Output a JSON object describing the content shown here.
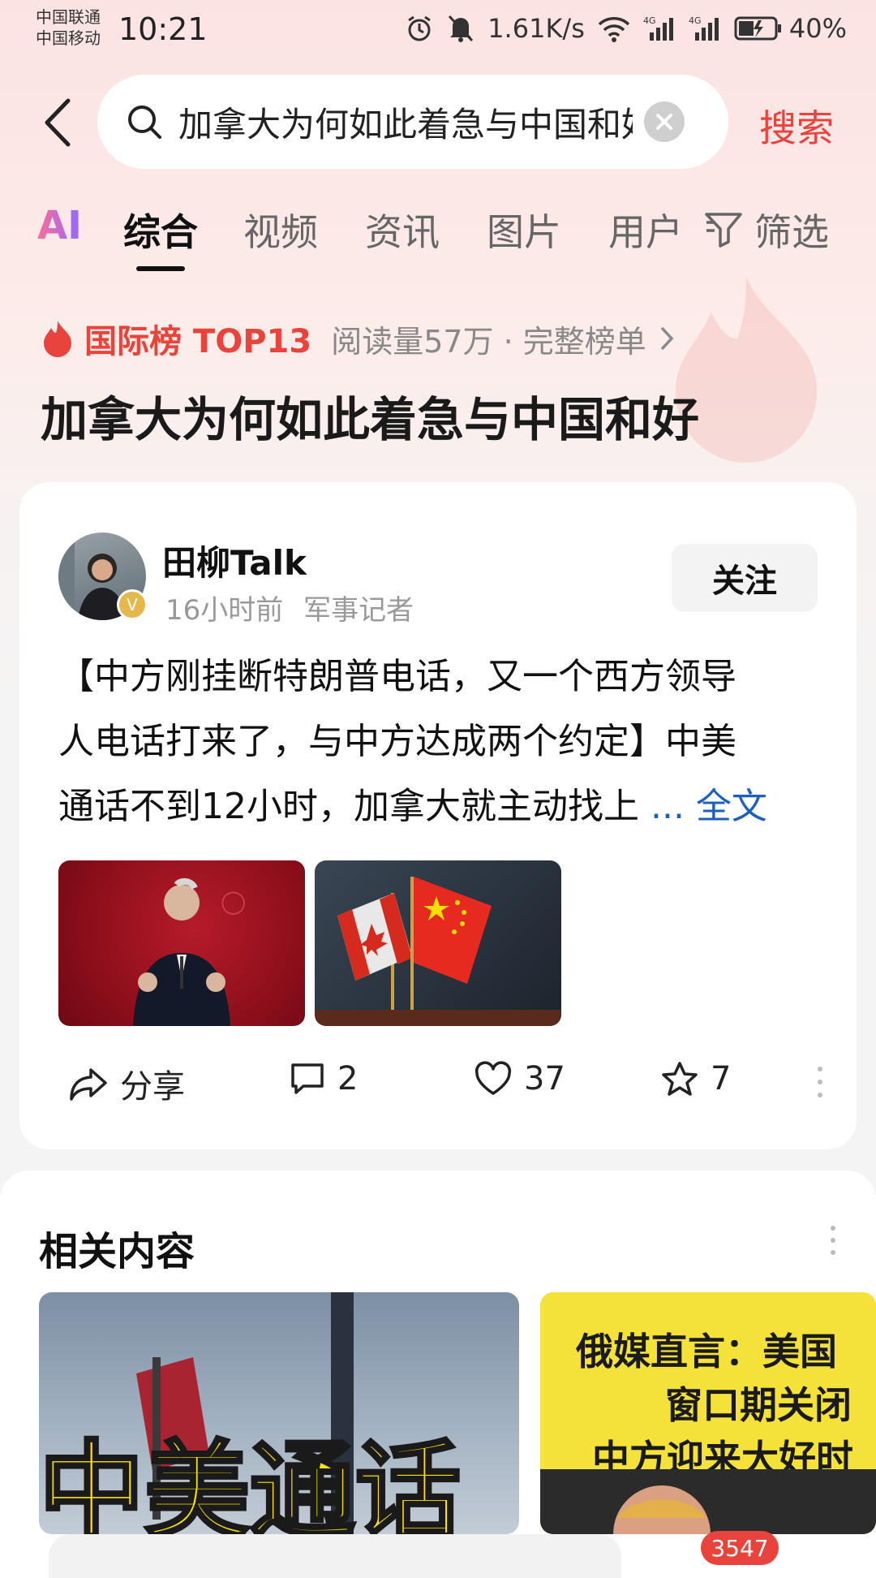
{
  "status_bar": {
    "carrier_1": "中国联通",
    "carrier_2": "中国移动",
    "time": "10:21",
    "network_speed": "1.61K/s",
    "signal_1_label": "4G",
    "signal_2_label": "4G",
    "battery": "40%",
    "icons": [
      "alarm-icon",
      "mute-icon",
      "wifi-icon",
      "signal-icon",
      "battery-icon"
    ]
  },
  "search": {
    "query": "加拿大为何如此着急与中国和好",
    "submit_label": "搜索"
  },
  "tabs": {
    "ai_label": "AI",
    "items": [
      "综合",
      "视频",
      "资讯",
      "图片",
      "用户"
    ],
    "active": "综合",
    "filter_label": "筛选"
  },
  "trending": {
    "rank_label": "国际榜 TOP13",
    "meta": "阅读量57万 · 完整榜单",
    "title": "加拿大为何如此着急与中国和好"
  },
  "post": {
    "author": "田柳Talk",
    "time_ago": "16小时前",
    "author_desc": "军事记者",
    "verified_badge": "V",
    "follow_label": "关注",
    "text_lines": [
      "【中方刚挂断特朗普电话，又一个西方领导",
      "人电话打来了，与中方达成两个约定】中美",
      "通话不到12小时，加拿大就主动找上 "
    ],
    "read_more": "... 全文",
    "share_label": "分享",
    "comments": "2",
    "likes": "37",
    "favorites": "7"
  },
  "related": {
    "title": "相关内容",
    "card1_text": "中美通话",
    "card2_lines": [
      "俄媒直言：美国",
      "窗口期关闭",
      "中方迎来大好时"
    ]
  },
  "bottom": {
    "comment_count": "3547"
  },
  "colors": {
    "accent": "#e9443b",
    "link": "#1d5fbf"
  }
}
